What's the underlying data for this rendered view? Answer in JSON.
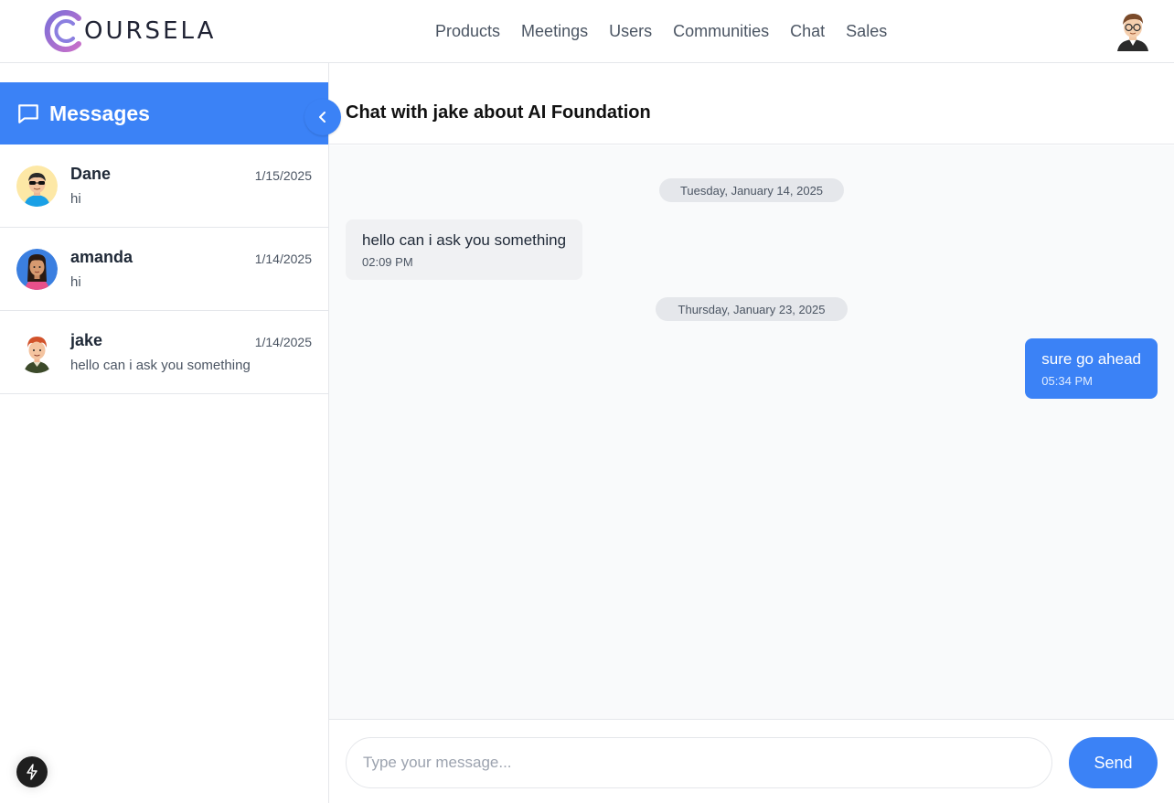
{
  "brand": {
    "logo_text": "OURSELA"
  },
  "nav": {
    "items": [
      "Products",
      "Meetings",
      "Users",
      "Communities",
      "Chat",
      "Sales"
    ]
  },
  "sidebar": {
    "title": "Messages",
    "conversations": [
      {
        "name": "Dane",
        "date": "1/15/2025",
        "preview": "hi"
      },
      {
        "name": "amanda",
        "date": "1/14/2025",
        "preview": "hi"
      },
      {
        "name": "jake",
        "date": "1/14/2025",
        "preview": "hello can i ask you something"
      }
    ]
  },
  "chat": {
    "title": "Chat with jake about AI Foundation",
    "groups": [
      {
        "date": "Tuesday, January 14, 2025",
        "message": {
          "text": "hello can i ask you something",
          "time": "02:09 PM",
          "direction": "incoming"
        }
      },
      {
        "date": "Thursday, January 23, 2025",
        "message": {
          "text": "sure go ahead",
          "time": "05:34 PM",
          "direction": "outgoing"
        }
      }
    ]
  },
  "composer": {
    "placeholder": "Type your message...",
    "send_label": "Send"
  },
  "colors": {
    "accent": "#3b82f6",
    "border": "#e5e7eb",
    "chat_bg": "#f9fafb"
  }
}
